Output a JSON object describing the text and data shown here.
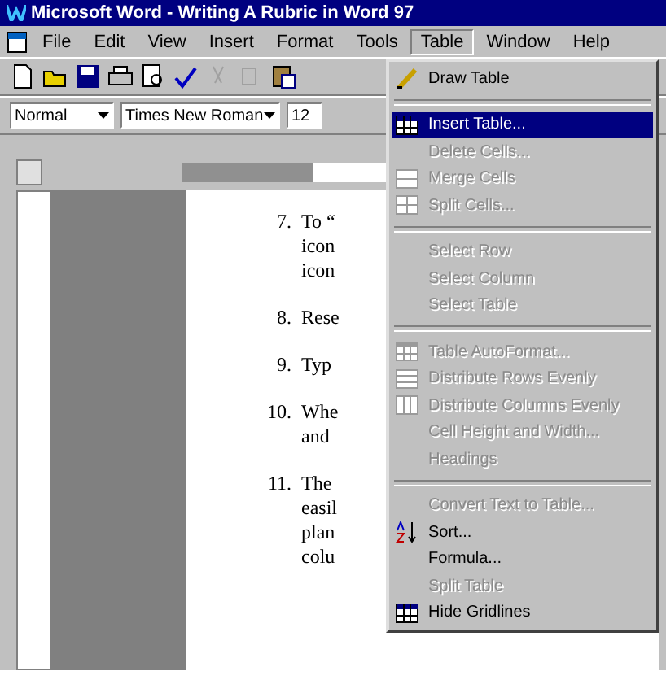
{
  "window": {
    "title": "Microsoft Word - Writing A Rubric in Word 97"
  },
  "menu_bar": [
    {
      "label": "File",
      "selected": false
    },
    {
      "label": "Edit",
      "selected": false
    },
    {
      "label": "View",
      "selected": false
    },
    {
      "label": "Insert",
      "selected": false
    },
    {
      "label": "Format",
      "selected": false
    },
    {
      "label": "Tools",
      "selected": false
    },
    {
      "label": "Table",
      "selected": true
    },
    {
      "label": "Window",
      "selected": false
    },
    {
      "label": "Help",
      "selected": false
    }
  ],
  "formatting": {
    "style": "Normal",
    "font": "Times New Roman",
    "size": "12"
  },
  "document": {
    "items": [
      {
        "number": "7.",
        "lines": [
          "To “",
          "icon",
          "icon"
        ]
      },
      {
        "number": "8.",
        "lines": [
          "Rese"
        ]
      },
      {
        "number": "9.",
        "lines": [
          "Typ"
        ]
      },
      {
        "number": "10.",
        "lines": [
          "Whe",
          "and"
        ]
      },
      {
        "number": "11.",
        "lines": [
          "The",
          "easil",
          "plan",
          "colu"
        ]
      }
    ]
  },
  "table_menu": [
    {
      "kind": "item",
      "label": "Draw Table",
      "disabled": false,
      "selected": false
    },
    {
      "kind": "separator"
    },
    {
      "kind": "item",
      "label": "Insert Table...",
      "disabled": false,
      "selected": true
    },
    {
      "kind": "item",
      "label": "Delete Cells...",
      "disabled": true,
      "selected": false
    },
    {
      "kind": "item",
      "label": "Merge Cells",
      "disabled": true,
      "selected": false
    },
    {
      "kind": "item",
      "label": "Split Cells...",
      "disabled": true,
      "selected": false
    },
    {
      "kind": "separator"
    },
    {
      "kind": "item",
      "label": "Select Row",
      "disabled": true,
      "selected": false
    },
    {
      "kind": "item",
      "label": "Select Column",
      "disabled": true,
      "selected": false
    },
    {
      "kind": "item",
      "label": "Select Table",
      "disabled": true,
      "selected": false
    },
    {
      "kind": "separator"
    },
    {
      "kind": "item",
      "label": "Table AutoFormat...",
      "disabled": true,
      "selected": false
    },
    {
      "kind": "item",
      "label": "Distribute Rows Evenly",
      "disabled": true,
      "selected": false
    },
    {
      "kind": "item",
      "label": "Distribute Columns Evenly",
      "disabled": true,
      "selected": false
    },
    {
      "kind": "item",
      "label": "Cell Height and Width...",
      "disabled": true,
      "selected": false
    },
    {
      "kind": "item",
      "label": "Headings",
      "disabled": true,
      "selected": false
    },
    {
      "kind": "separator"
    },
    {
      "kind": "item",
      "label": "Convert Text to Table...",
      "disabled": true,
      "selected": false
    },
    {
      "kind": "item",
      "label": "Sort...",
      "disabled": false,
      "selected": false
    },
    {
      "kind": "item",
      "label": "Formula...",
      "disabled": false,
      "selected": false
    },
    {
      "kind": "item",
      "label": "Split Table",
      "disabled": true,
      "selected": false
    },
    {
      "kind": "item",
      "label": "Hide Gridlines",
      "disabled": false,
      "selected": false
    }
  ]
}
